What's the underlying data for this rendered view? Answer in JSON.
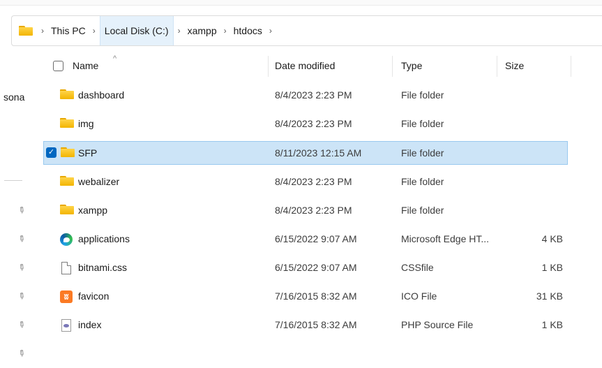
{
  "address": {
    "crumbs": [
      "This PC",
      "Local Disk (C:)",
      "xampp",
      "htdocs"
    ],
    "separator": "›"
  },
  "nav": {
    "partial_label": "sona",
    "pin_icon": "pin-icon"
  },
  "columns": {
    "name": "Name",
    "date": "Date modified",
    "type": "Type",
    "size": "Size",
    "sort_indicator": "^"
  },
  "files": [
    {
      "name": "dashboard",
      "date": "8/4/2023 2:23 PM",
      "type": "File folder",
      "size": "",
      "icon": "folder-icon"
    },
    {
      "name": "img",
      "date": "8/4/2023 2:23 PM",
      "type": "File folder",
      "size": "",
      "icon": "folder-icon"
    },
    {
      "name": "SFP",
      "date": "8/11/2023 12:15 AM",
      "type": "File folder",
      "size": "",
      "icon": "folder-icon",
      "selected": true
    },
    {
      "name": "webalizer",
      "date": "8/4/2023 2:23 PM",
      "type": "File folder",
      "size": "",
      "icon": "folder-icon"
    },
    {
      "name": "xampp",
      "date": "8/4/2023 2:23 PM",
      "type": "File folder",
      "size": "",
      "icon": "folder-icon"
    },
    {
      "name": "applications",
      "date": "6/15/2022 9:07 AM",
      "type": "Microsoft Edge HT...",
      "size": "4 KB",
      "icon": "edge-icon"
    },
    {
      "name": "bitnami.css",
      "date": "6/15/2022 9:07 AM",
      "type": "CSSfile",
      "size": "1 KB",
      "icon": "document-icon"
    },
    {
      "name": "favicon",
      "date": "7/16/2015 8:32 AM",
      "type": "ICO File",
      "size": "31 KB",
      "icon": "xampp-icon"
    },
    {
      "name": "index",
      "date": "7/16/2015 8:32 AM",
      "type": "PHP Source File",
      "size": "1 KB",
      "icon": "php-file-icon"
    }
  ],
  "colors": {
    "selection_bg": "#cce4f7",
    "selection_border": "#99c9ef",
    "checkbox_accent": "#0067c0",
    "active_crumb_bg": "#e5f1fb"
  }
}
